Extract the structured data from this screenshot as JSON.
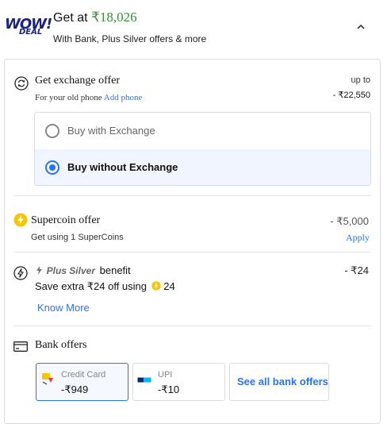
{
  "header": {
    "logo_main": "WOW!",
    "logo_sub": "DEAL",
    "get_at_prefix": "Get at",
    "price": "₹18,026",
    "subtitle": "With Bank, Plus Silver offers & more"
  },
  "exchange": {
    "title": "Get exchange offer",
    "subtitle_prefix": "For your old phone",
    "add_phone": "Add phone",
    "upto_label": "up to",
    "upto_amount": "- ₹22,550",
    "options": [
      {
        "label": "Buy with Exchange",
        "selected": false
      },
      {
        "label": "Buy without Exchange",
        "selected": true
      }
    ]
  },
  "supercoin": {
    "title": "Supercoin offer",
    "subtitle": "Get using 1 SuperCoins",
    "amount": "- ₹5,000",
    "apply": "Apply"
  },
  "plus_silver": {
    "brand": "Plus Silver",
    "title_suffix": "benefit",
    "amount": "- ₹24",
    "desc_prefix": "Save extra ₹24 off using",
    "coins": "24",
    "know_more": "Know More"
  },
  "bank": {
    "title": "Bank offers",
    "tiles": [
      {
        "label": "Credit Card",
        "value": "-₹949",
        "selected": true
      },
      {
        "label": "UPI",
        "value": "-₹10",
        "selected": false
      }
    ],
    "see_all": "See all bank offers"
  },
  "colors": {
    "accent": "#2874f0",
    "price_green": "#388e3c",
    "coin_yellow": "#f7c600"
  }
}
